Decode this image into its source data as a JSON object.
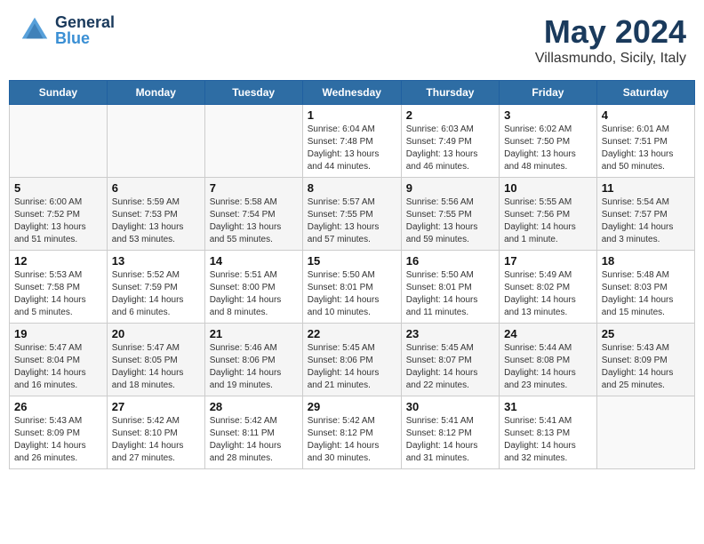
{
  "header": {
    "logo_general": "General",
    "logo_blue": "Blue",
    "month": "May 2024",
    "location": "Villasmundo, Sicily, Italy"
  },
  "days_of_week": [
    "Sunday",
    "Monday",
    "Tuesday",
    "Wednesday",
    "Thursday",
    "Friday",
    "Saturday"
  ],
  "weeks": [
    [
      {
        "day": "",
        "sunrise": "",
        "sunset": "",
        "daylight": ""
      },
      {
        "day": "",
        "sunrise": "",
        "sunset": "",
        "daylight": ""
      },
      {
        "day": "",
        "sunrise": "",
        "sunset": "",
        "daylight": ""
      },
      {
        "day": "1",
        "sunrise": "Sunrise: 6:04 AM",
        "sunset": "Sunset: 7:48 PM",
        "daylight": "Daylight: 13 hours and 44 minutes."
      },
      {
        "day": "2",
        "sunrise": "Sunrise: 6:03 AM",
        "sunset": "Sunset: 7:49 PM",
        "daylight": "Daylight: 13 hours and 46 minutes."
      },
      {
        "day": "3",
        "sunrise": "Sunrise: 6:02 AM",
        "sunset": "Sunset: 7:50 PM",
        "daylight": "Daylight: 13 hours and 48 minutes."
      },
      {
        "day": "4",
        "sunrise": "Sunrise: 6:01 AM",
        "sunset": "Sunset: 7:51 PM",
        "daylight": "Daylight: 13 hours and 50 minutes."
      }
    ],
    [
      {
        "day": "5",
        "sunrise": "Sunrise: 6:00 AM",
        "sunset": "Sunset: 7:52 PM",
        "daylight": "Daylight: 13 hours and 51 minutes."
      },
      {
        "day": "6",
        "sunrise": "Sunrise: 5:59 AM",
        "sunset": "Sunset: 7:53 PM",
        "daylight": "Daylight: 13 hours and 53 minutes."
      },
      {
        "day": "7",
        "sunrise": "Sunrise: 5:58 AM",
        "sunset": "Sunset: 7:54 PM",
        "daylight": "Daylight: 13 hours and 55 minutes."
      },
      {
        "day": "8",
        "sunrise": "Sunrise: 5:57 AM",
        "sunset": "Sunset: 7:55 PM",
        "daylight": "Daylight: 13 hours and 57 minutes."
      },
      {
        "day": "9",
        "sunrise": "Sunrise: 5:56 AM",
        "sunset": "Sunset: 7:55 PM",
        "daylight": "Daylight: 13 hours and 59 minutes."
      },
      {
        "day": "10",
        "sunrise": "Sunrise: 5:55 AM",
        "sunset": "Sunset: 7:56 PM",
        "daylight": "Daylight: 14 hours and 1 minute."
      },
      {
        "day": "11",
        "sunrise": "Sunrise: 5:54 AM",
        "sunset": "Sunset: 7:57 PM",
        "daylight": "Daylight: 14 hours and 3 minutes."
      }
    ],
    [
      {
        "day": "12",
        "sunrise": "Sunrise: 5:53 AM",
        "sunset": "Sunset: 7:58 PM",
        "daylight": "Daylight: 14 hours and 5 minutes."
      },
      {
        "day": "13",
        "sunrise": "Sunrise: 5:52 AM",
        "sunset": "Sunset: 7:59 PM",
        "daylight": "Daylight: 14 hours and 6 minutes."
      },
      {
        "day": "14",
        "sunrise": "Sunrise: 5:51 AM",
        "sunset": "Sunset: 8:00 PM",
        "daylight": "Daylight: 14 hours and 8 minutes."
      },
      {
        "day": "15",
        "sunrise": "Sunrise: 5:50 AM",
        "sunset": "Sunset: 8:01 PM",
        "daylight": "Daylight: 14 hours and 10 minutes."
      },
      {
        "day": "16",
        "sunrise": "Sunrise: 5:50 AM",
        "sunset": "Sunset: 8:01 PM",
        "daylight": "Daylight: 14 hours and 11 minutes."
      },
      {
        "day": "17",
        "sunrise": "Sunrise: 5:49 AM",
        "sunset": "Sunset: 8:02 PM",
        "daylight": "Daylight: 14 hours and 13 minutes."
      },
      {
        "day": "18",
        "sunrise": "Sunrise: 5:48 AM",
        "sunset": "Sunset: 8:03 PM",
        "daylight": "Daylight: 14 hours and 15 minutes."
      }
    ],
    [
      {
        "day": "19",
        "sunrise": "Sunrise: 5:47 AM",
        "sunset": "Sunset: 8:04 PM",
        "daylight": "Daylight: 14 hours and 16 minutes."
      },
      {
        "day": "20",
        "sunrise": "Sunrise: 5:47 AM",
        "sunset": "Sunset: 8:05 PM",
        "daylight": "Daylight: 14 hours and 18 minutes."
      },
      {
        "day": "21",
        "sunrise": "Sunrise: 5:46 AM",
        "sunset": "Sunset: 8:06 PM",
        "daylight": "Daylight: 14 hours and 19 minutes."
      },
      {
        "day": "22",
        "sunrise": "Sunrise: 5:45 AM",
        "sunset": "Sunset: 8:06 PM",
        "daylight": "Daylight: 14 hours and 21 minutes."
      },
      {
        "day": "23",
        "sunrise": "Sunrise: 5:45 AM",
        "sunset": "Sunset: 8:07 PM",
        "daylight": "Daylight: 14 hours and 22 minutes."
      },
      {
        "day": "24",
        "sunrise": "Sunrise: 5:44 AM",
        "sunset": "Sunset: 8:08 PM",
        "daylight": "Daylight: 14 hours and 23 minutes."
      },
      {
        "day": "25",
        "sunrise": "Sunrise: 5:43 AM",
        "sunset": "Sunset: 8:09 PM",
        "daylight": "Daylight: 14 hours and 25 minutes."
      }
    ],
    [
      {
        "day": "26",
        "sunrise": "Sunrise: 5:43 AM",
        "sunset": "Sunset: 8:09 PM",
        "daylight": "Daylight: 14 hours and 26 minutes."
      },
      {
        "day": "27",
        "sunrise": "Sunrise: 5:42 AM",
        "sunset": "Sunset: 8:10 PM",
        "daylight": "Daylight: 14 hours and 27 minutes."
      },
      {
        "day": "28",
        "sunrise": "Sunrise: 5:42 AM",
        "sunset": "Sunset: 8:11 PM",
        "daylight": "Daylight: 14 hours and 28 minutes."
      },
      {
        "day": "29",
        "sunrise": "Sunrise: 5:42 AM",
        "sunset": "Sunset: 8:12 PM",
        "daylight": "Daylight: 14 hours and 30 minutes."
      },
      {
        "day": "30",
        "sunrise": "Sunrise: 5:41 AM",
        "sunset": "Sunset: 8:12 PM",
        "daylight": "Daylight: 14 hours and 31 minutes."
      },
      {
        "day": "31",
        "sunrise": "Sunrise: 5:41 AM",
        "sunset": "Sunset: 8:13 PM",
        "daylight": "Daylight: 14 hours and 32 minutes."
      },
      {
        "day": "",
        "sunrise": "",
        "sunset": "",
        "daylight": ""
      }
    ]
  ]
}
